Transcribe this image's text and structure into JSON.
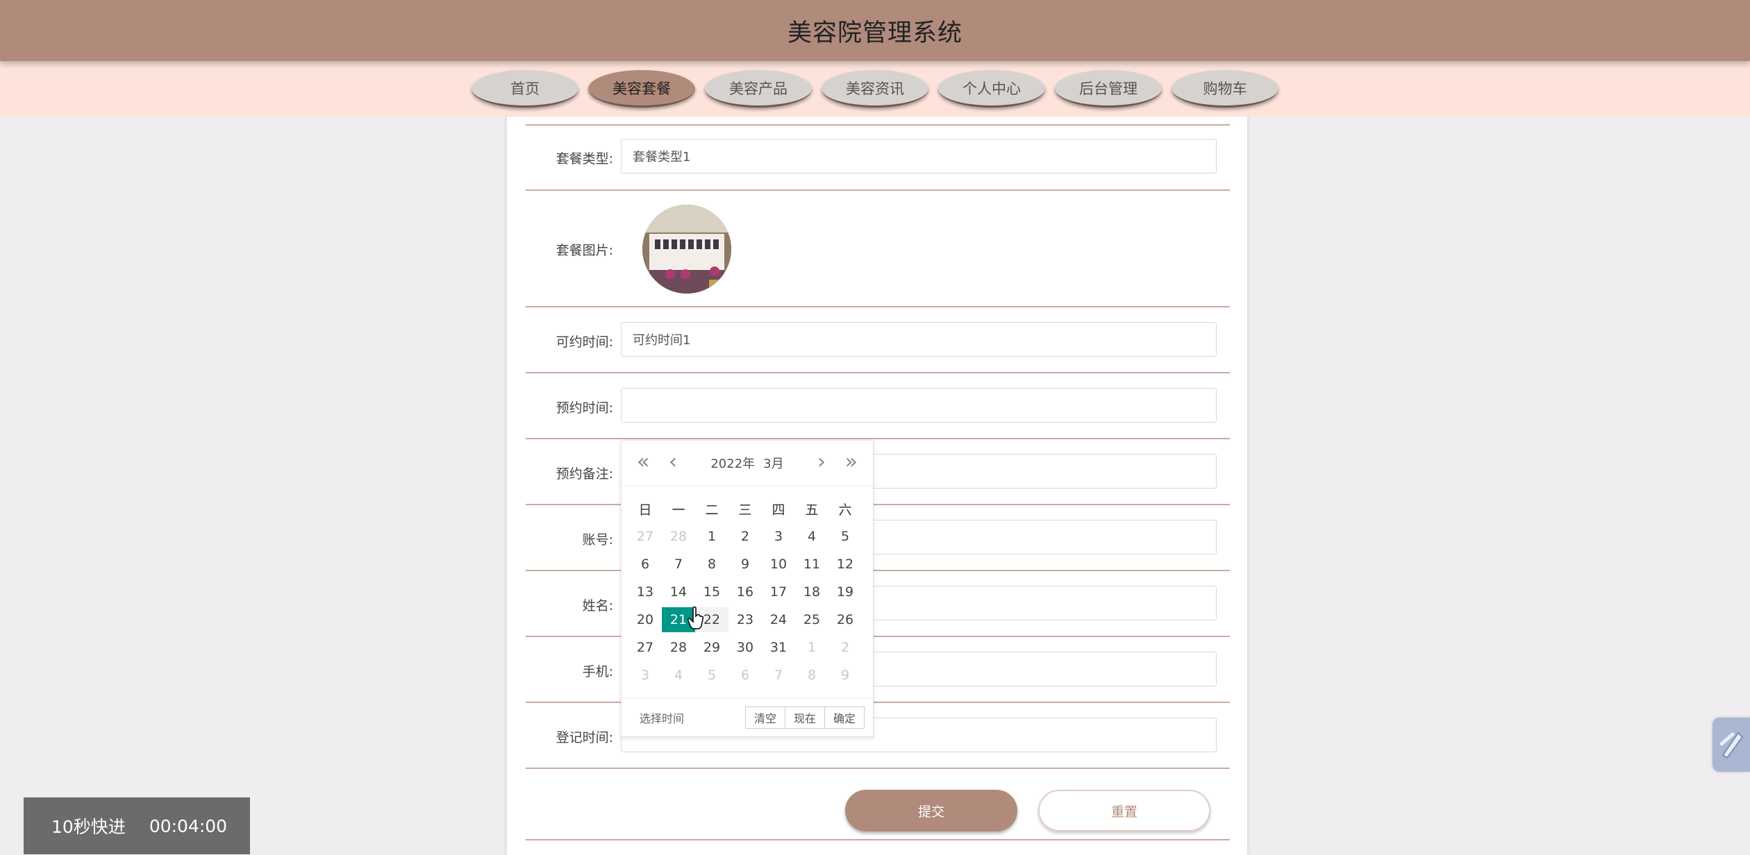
{
  "header": {
    "title": "美容院管理系统"
  },
  "nav": {
    "items": [
      {
        "label": "首页"
      },
      {
        "label": "美容套餐"
      },
      {
        "label": "美容产品"
      },
      {
        "label": "美容资讯"
      },
      {
        "label": "个人中心"
      },
      {
        "label": "后台管理"
      },
      {
        "label": "购物车"
      }
    ],
    "active": "美容套餐"
  },
  "form": {
    "package_type": {
      "label": "套餐类型:",
      "value": "套餐类型1"
    },
    "package_image": {
      "label": "套餐图片:"
    },
    "available_time": {
      "label": "可约时间:",
      "value": "可约时间1"
    },
    "booking_time": {
      "label": "预约时间:",
      "value": ""
    },
    "booking_note": {
      "label": "预约备注:",
      "value": ""
    },
    "account": {
      "label": "账号:",
      "value": ""
    },
    "name": {
      "label": "姓名:",
      "value": ""
    },
    "phone": {
      "label": "手机:",
      "value": ""
    },
    "register_time": {
      "label": "登记时间:",
      "value": ""
    },
    "submit_label": "提交",
    "reset_label": "重置"
  },
  "calendar": {
    "year_label": "2022年",
    "month_label": "3月",
    "weekdays": [
      "日",
      "一",
      "二",
      "三",
      "四",
      "五",
      "六"
    ],
    "weeks": [
      [
        "27",
        "28",
        "1",
        "2",
        "3",
        "4",
        "5"
      ],
      [
        "6",
        "7",
        "8",
        "9",
        "10",
        "11",
        "12"
      ],
      [
        "13",
        "14",
        "15",
        "16",
        "17",
        "18",
        "19"
      ],
      [
        "20",
        "21",
        "22",
        "23",
        "24",
        "25",
        "26"
      ],
      [
        "27",
        "28",
        "29",
        "30",
        "31",
        "1",
        "2"
      ],
      [
        "3",
        "4",
        "5",
        "6",
        "7",
        "8",
        "9"
      ]
    ],
    "selected": "21",
    "footer": {
      "pick_time": "选择时间",
      "clear": "清空",
      "now": "现在",
      "confirm": "确定"
    },
    "accent_color": "#009688"
  },
  "video_overlay": {
    "fast_forward": "10秒快进",
    "time": "00:04:00"
  },
  "colors": {
    "header": "#b08a7b",
    "nav_bg": "#fde3da",
    "page_bg": "#efedf0"
  }
}
